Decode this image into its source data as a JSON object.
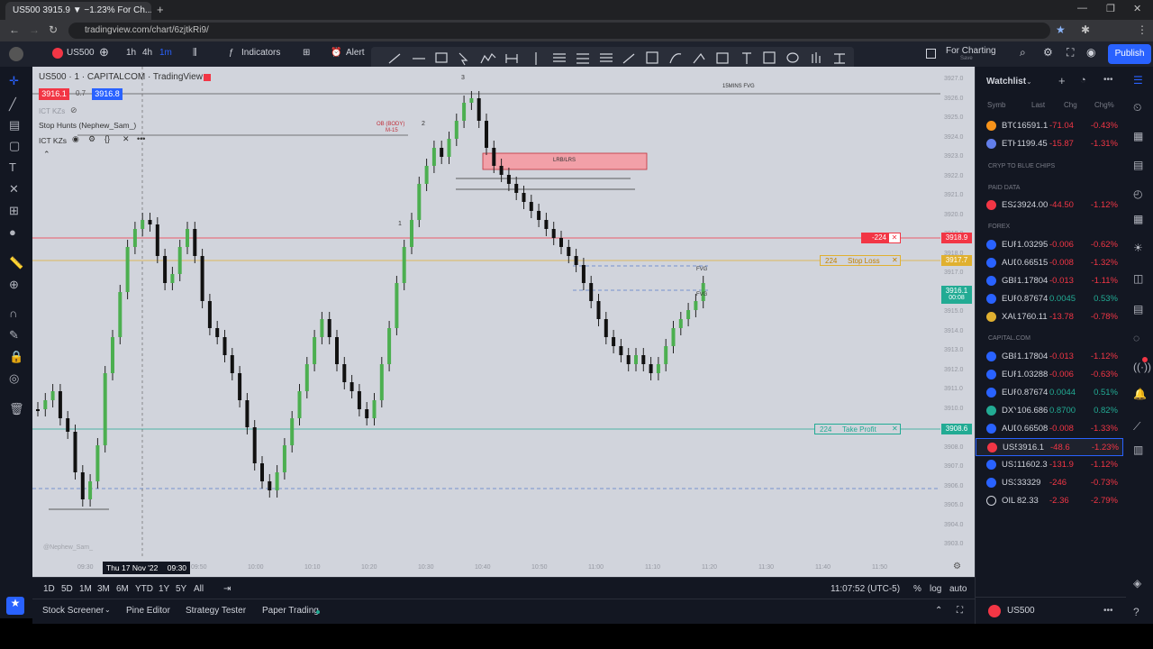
{
  "browser": {
    "tab_title": "US500 3915.9 ▼ −1.23% For Ch...",
    "url": "tradingview.com/chart/6zjtkRi9/"
  },
  "toolbar": {
    "symbol": "US500",
    "intervals": [
      "1h",
      "4h",
      "1m"
    ],
    "indicators_label": "Indicators",
    "alert_label": "Alert",
    "for_charting_label": "For Charting",
    "for_charting_sub": "Save",
    "publish_label": "Publish"
  },
  "chart": {
    "legend_title": "US500 · 1 · CAPITALCOM · TradingView",
    "bid": "3916.1",
    "spread": "0.7",
    "ask": "3916.8",
    "indicator_ict1": "ICT KZs",
    "indicator_stop_hunts": "Stop Hunts (Nephew_Sam_)",
    "indicator_ict2": "ICT KZs",
    "label_15mins_fvg": "15MINS FVG",
    "label_ob_body": "OB (BODY)",
    "label_ob_tf": "M-15",
    "label_lrb": "LRB/LRS",
    "label_fvg1": "FVG",
    "label_fvg2": "FVG",
    "label_num3": "3",
    "label_num2": "2",
    "label_num1": "1",
    "watermark": "@Nephew_Sam_",
    "stop_loss": {
      "qty": "224",
      "label": "Stop Loss",
      "price": "3917.7"
    },
    "take_profit": {
      "qty": "224",
      "label": "Take Profit",
      "price": "3908.6"
    },
    "position": {
      "pnl": "-224",
      "price": "3918.9"
    },
    "current_price": "3916.1",
    "countdown": "00:08",
    "price_ticks": [
      "3927.0",
      "3926.0",
      "3925.0",
      "3924.0",
      "3923.0",
      "3922.0",
      "3921.0",
      "3920.0",
      "3919.0",
      "3918.0",
      "3917.0",
      "3916.0",
      "3915.0",
      "3914.0",
      "3913.0",
      "3912.0",
      "3911.0",
      "3910.0",
      "3909.0",
      "3908.0",
      "3907.0",
      "3906.0",
      "3905.0",
      "3904.0",
      "3903.0"
    ],
    "time_cursor": "Thu 17 Nov '22",
    "time_cursor_time": "09:30",
    "time_ticks": [
      "09:30",
      "09:40",
      "09:50",
      "10:00",
      "10:10",
      "10:20",
      "10:30",
      "10:40",
      "10:50",
      "11:00",
      "11:10",
      "11:20",
      "11:30",
      "11:40",
      "11:50"
    ]
  },
  "range_bar": {
    "ranges": [
      "1D",
      "5D",
      "1M",
      "3M",
      "6M",
      "YTD",
      "1Y",
      "5Y",
      "All"
    ],
    "clock": "11:07:52 (UTC-5)",
    "pct": "%",
    "log": "log",
    "auto": "auto"
  },
  "bottom": {
    "tabs": [
      "Stock Screener",
      "Pine Editor",
      "Strategy Tester",
      "Paper Trading"
    ],
    "details_symbol": "US500"
  },
  "watchlist": {
    "title": "Watchlist",
    "columns": [
      "Symb",
      "Last",
      "Chg",
      "Chg%"
    ],
    "sections": [
      "CRYP TO BLUE CHIPS",
      "PAID DATA",
      "FOREX",
      "CAPITAL.COM"
    ],
    "rows": [
      {
        "sym": "BTC",
        "last": "16591.1",
        "chg": "-71.04",
        "pct": "-0.43%",
        "color": "#f7931a",
        "dir": "neg"
      },
      {
        "sym": "ETH",
        "last": "1199.45",
        "chg": "-15.87",
        "pct": "-1.31%",
        "color": "#627eea",
        "dir": "neg"
      },
      {
        "sym": "ES2",
        "last": "3924.00",
        "chg": "-44.50",
        "pct": "-1.12%",
        "color": "#f23645",
        "dir": "neg"
      },
      {
        "sym": "EUR",
        "last": "1.03295",
        "chg": "-0.006",
        "pct": "-0.62%",
        "color": "#2962ff",
        "dir": "neg"
      },
      {
        "sym": "AUD",
        "last": "0.66515",
        "chg": "-0.008",
        "pct": "-1.32%",
        "color": "#2962ff",
        "dir": "neg"
      },
      {
        "sym": "GBP",
        "last": "1.17804",
        "chg": "-0.013",
        "pct": "-1.11%",
        "color": "#2962ff",
        "dir": "neg"
      },
      {
        "sym": "EUR",
        "last": "0.87674",
        "chg": "0.0045",
        "pct": "0.53%",
        "color": "#2962ff",
        "dir": "pos"
      },
      {
        "sym": "XAU",
        "last": "1760.11",
        "chg": "-13.78",
        "pct": "-0.78%",
        "color": "#e0b030",
        "dir": "neg"
      },
      {
        "sym": "GBP",
        "last": "1.17804",
        "chg": "-0.013",
        "pct": "-1.12%",
        "color": "#2962ff",
        "dir": "neg"
      },
      {
        "sym": "EUR",
        "last": "1.03288",
        "chg": "-0.006",
        "pct": "-0.63%",
        "color": "#2962ff",
        "dir": "neg"
      },
      {
        "sym": "EUR",
        "last": "0.87674",
        "chg": "0.0044",
        "pct": "0.51%",
        "color": "#2962ff",
        "dir": "pos"
      },
      {
        "sym": "DXY",
        "last": "106.686",
        "chg": "0.8700",
        "pct": "0.82%",
        "color": "#22ab94",
        "dir": "pos"
      },
      {
        "sym": "AUD",
        "last": "0.66508",
        "chg": "-0.008",
        "pct": "-1.33%",
        "color": "#2962ff",
        "dir": "neg"
      },
      {
        "sym": "US5",
        "last": "3916.1",
        "chg": "-48.6",
        "pct": "-1.23%",
        "color": "#f23645",
        "dir": "neg"
      },
      {
        "sym": "US1",
        "last": "11602.3",
        "chg": "-131.9",
        "pct": "-1.12%",
        "color": "#2962ff",
        "dir": "neg"
      },
      {
        "sym": "US3",
        "last": "33329",
        "chg": "-246",
        "pct": "-0.73%",
        "color": "#2962ff",
        "dir": "neg"
      },
      {
        "sym": "OIL",
        "last": "82.33",
        "chg": "-2.36",
        "pct": "-2.79%",
        "color": "#131722",
        "dir": "neg"
      }
    ]
  }
}
